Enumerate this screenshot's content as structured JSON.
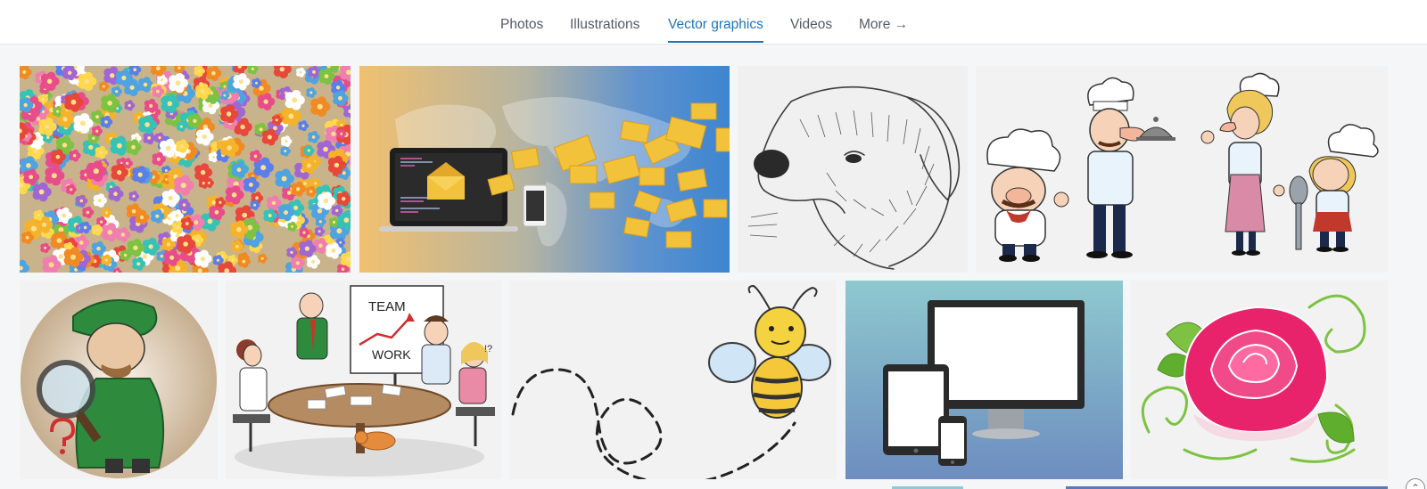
{
  "tabs": [
    {
      "label": "Photos",
      "active": false
    },
    {
      "label": "Illustrations",
      "active": false
    },
    {
      "label": "Vector graphics",
      "active": true
    },
    {
      "label": "Videos",
      "active": false
    },
    {
      "label": "More →",
      "active": false
    }
  ],
  "accent_color": "#1f73b7",
  "gallery": {
    "row1": [
      {
        "subject": "colorful flowers pattern"
      },
      {
        "subject": "email laptop world map"
      },
      {
        "subject": "dog sketch"
      },
      {
        "subject": "cartoon chefs"
      }
    ],
    "row2": [
      {
        "subject": "detective with magnifying glass"
      },
      {
        "subject": "team meeting",
        "board_text_1": "TEAM",
        "board_text_2": "WORK"
      },
      {
        "subject": "bee flight path"
      },
      {
        "subject": "computer devices"
      },
      {
        "subject": "pink rose"
      }
    ]
  }
}
